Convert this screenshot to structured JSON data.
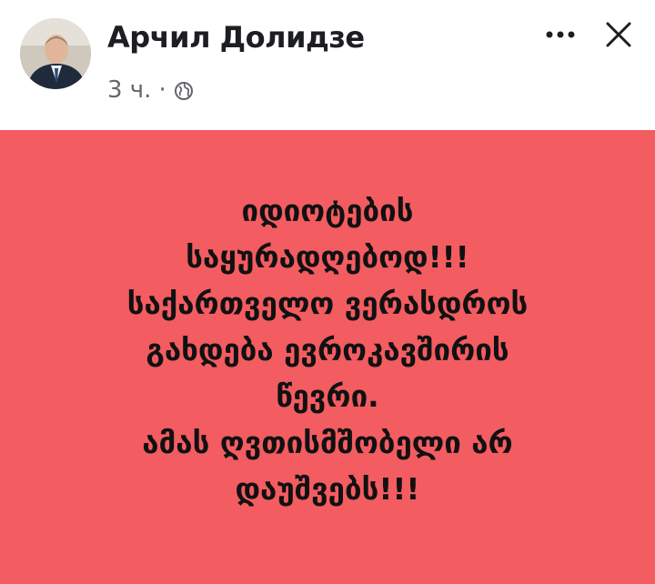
{
  "post": {
    "author_name": "Арчил Долидзе",
    "timestamp": "3 ч.",
    "separator": "·",
    "privacy_icon": "globe-icon",
    "more_icon": "more-options-icon",
    "close_icon": "close-icon",
    "background_color": "#f35c61",
    "text_lines": [
      "იდიოტების",
      "საყურადღებოდ!!!",
      "საქართველო ვერასდროს",
      "გახდება ევროკავშირის",
      "წევრი.",
      "ამას ღვთისმშობელი არ",
      "დაუშვებს!!!"
    ]
  }
}
